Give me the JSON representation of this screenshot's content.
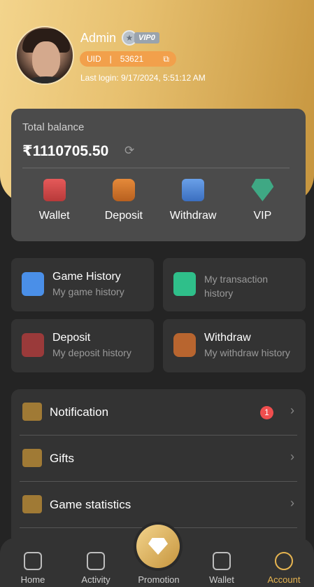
{
  "profile": {
    "name": "Admin",
    "vip_tag": "VIP0",
    "uid_label": "UID",
    "uid_sep": "|",
    "uid_value": "53621",
    "last_login": "Last login: 9/17/2024, 5:51:12 AM"
  },
  "balance": {
    "label": "Total balance",
    "amount": "₹1110705.50",
    "actions": [
      {
        "label": "Wallet",
        "icon": "wallet-icon"
      },
      {
        "label": "Deposit",
        "icon": "deposit-icon"
      },
      {
        "label": "Withdraw",
        "icon": "withdraw-icon"
      },
      {
        "label": "VIP",
        "icon": "vip-icon"
      }
    ]
  },
  "tiles": {
    "game_history": {
      "title": "Game History",
      "sub": "My game history"
    },
    "transaction": {
      "sub": "My transaction history"
    },
    "deposit": {
      "title": "Deposit",
      "sub": "My deposit history"
    },
    "withdraw": {
      "title": "Withdraw",
      "sub": "My withdraw history"
    }
  },
  "menu": [
    {
      "label": "Notification",
      "badge": "1"
    },
    {
      "label": "Gifts"
    },
    {
      "label": "Game statistics"
    }
  ],
  "tabbar": [
    {
      "label": "Home"
    },
    {
      "label": "Activity"
    },
    {
      "label": "Promotion"
    },
    {
      "label": "Wallet"
    },
    {
      "label": "Account",
      "active": true
    }
  ],
  "colors": {
    "accent": "#e6b450",
    "badge": "#f04e4e"
  }
}
